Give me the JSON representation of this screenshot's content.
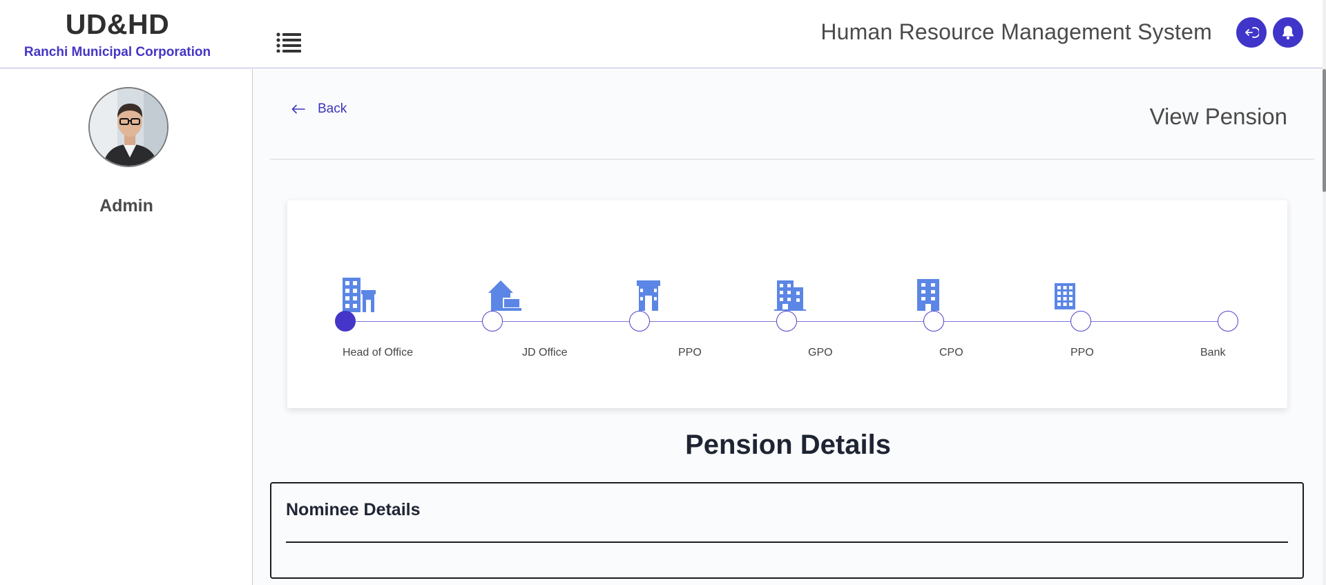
{
  "header": {
    "brand_title": "UD&HD",
    "brand_subtitle": "Ranchi Municipal Corporation",
    "app_title": "Human Resource Management System",
    "menu_icon": "list-icon",
    "logout_icon": "logout-icon",
    "notification_icon": "bell-icon"
  },
  "sidebar": {
    "user_name": "Admin",
    "avatar_icon": "user-avatar"
  },
  "main": {
    "back_label": "Back",
    "page_title": "View Pension",
    "pension_heading": "Pension Details",
    "nominee_title": "Nominee Details"
  },
  "stepper": {
    "steps": [
      {
        "label": "Head of Office",
        "icon": "office-building-icon",
        "active": true
      },
      {
        "label": "JD Office",
        "icon": "home-work-icon",
        "active": false
      },
      {
        "label": "PPO",
        "icon": "gate-building-icon",
        "active": false
      },
      {
        "label": "GPO",
        "icon": "apartment-icon",
        "active": false
      },
      {
        "label": "CPO",
        "icon": "tall-building-icon",
        "active": false
      },
      {
        "label": "PPO",
        "icon": "grid-building-icon",
        "active": false
      },
      {
        "label": "Bank",
        "icon": "",
        "active": false
      }
    ]
  },
  "colors": {
    "accent": "#4536c9",
    "step_icon": "#5b86e5",
    "brand_subtitle": "#4535c4"
  }
}
